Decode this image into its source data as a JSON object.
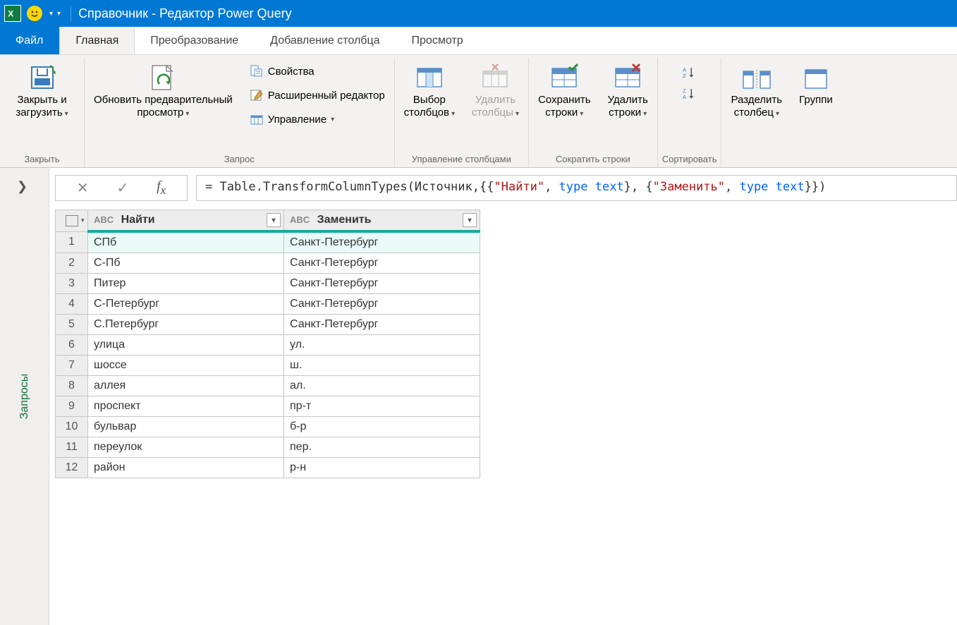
{
  "titlebar": {
    "title": "Справочник - Редактор Power Query"
  },
  "tabs": {
    "file": "Файл",
    "home": "Главная",
    "transform": "Преобразование",
    "addcol": "Добавление столбца",
    "view": "Просмотр"
  },
  "ribbon": {
    "close": {
      "label": "Закрыть и\nзагрузить",
      "group": "Закрыть"
    },
    "query_group": "Запрос",
    "refresh": "Обновить предварительный\nпросмотр",
    "props": "Свойства",
    "adv_editor": "Расширенный редактор",
    "manage": "Управление",
    "cols_group": "Управление столбцами",
    "choose_cols": "Выбор\nстолбцов",
    "remove_cols": "Удалить\nстолбцы",
    "rows_group": "Сократить строки",
    "keep_rows": "Сохранить\nстроки",
    "remove_rows": "Удалить\nстроки",
    "sort_group": "Сортировать",
    "split_group": "",
    "split": "Разделить\nстолбец",
    "group_by": "Группи"
  },
  "side": {
    "label": "Запросы"
  },
  "formula": {
    "prefix": "= Table.TransformColumnTypes(Источник,{{",
    "s1": "\"Найти\"",
    "mid1": ", ",
    "kw": "type text",
    "mid2": "}, {",
    "s2": "\"Заменить\"",
    "mid3": ", ",
    "suffix": "}})"
  },
  "table": {
    "col1": "Найти",
    "col2": "Заменить",
    "type_prefix": "AВC",
    "rows": [
      {
        "n": "1",
        "a": "СПб",
        "b": "Санкт-Петербург"
      },
      {
        "n": "2",
        "a": "С-Пб",
        "b": "Санкт-Петербург"
      },
      {
        "n": "3",
        "a": "Питер",
        "b": "Санкт-Петербург"
      },
      {
        "n": "4",
        "a": "С-Петербург",
        "b": "Санкт-Петербург"
      },
      {
        "n": "5",
        "a": "С.Петербург",
        "b": "Санкт-Петербург"
      },
      {
        "n": "6",
        "a": "улица",
        "b": "ул."
      },
      {
        "n": "7",
        "a": "шоссе",
        "b": "ш."
      },
      {
        "n": "8",
        "a": "аллея",
        "b": "ал."
      },
      {
        "n": "9",
        "a": "проспект",
        "b": "пр-т"
      },
      {
        "n": "10",
        "a": "бульвар",
        "b": "б-р"
      },
      {
        "n": "11",
        "a": "переулок",
        "b": "пер."
      },
      {
        "n": "12",
        "a": "район",
        "b": "р-н"
      }
    ]
  }
}
